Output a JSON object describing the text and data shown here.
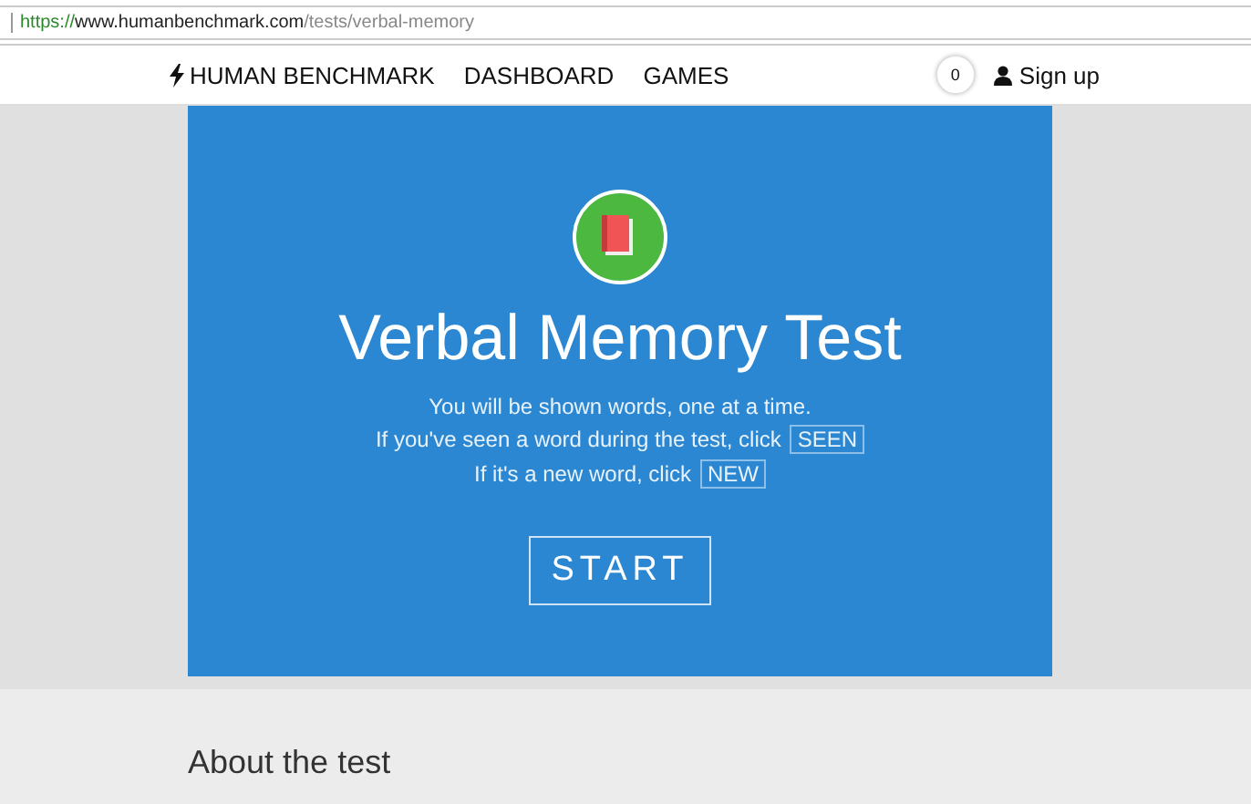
{
  "address_bar": {
    "scheme": "https://",
    "host": "www.humanbenchmark.com",
    "path": "/tests/verbal-memory"
  },
  "nav": {
    "brand": "HUMAN BENCHMARK",
    "links": [
      "DASHBOARD",
      "GAMES"
    ],
    "counter": "0",
    "signup": "Sign up"
  },
  "hero": {
    "title": "Verbal Memory Test",
    "lines": [
      {
        "text": "You will be shown words, one at a time."
      },
      {
        "text": "If you've seen a word during the test, click",
        "key": "SEEN"
      },
      {
        "text": "If it's a new word, click",
        "key": "NEW"
      }
    ],
    "button": "START"
  },
  "about": {
    "heading": "About the test"
  }
}
